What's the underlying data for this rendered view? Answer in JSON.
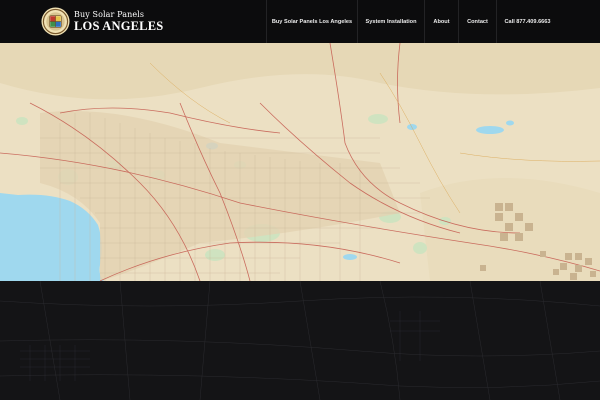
{
  "brand": {
    "line1": "Buy Solar Panels",
    "line2": "LOS ANGELES",
    "seal_icon": "city-seal-icon"
  },
  "nav": {
    "items": [
      {
        "label": "Buy Solar Panels Los Angeles"
      },
      {
        "label": "System Installation"
      },
      {
        "label": "About"
      },
      {
        "label": "Contact"
      },
      {
        "label": "Call 877.409.6663"
      }
    ]
  },
  "colors": {
    "header_bg": "#0c0c0d",
    "map_land": "#ece0c3",
    "map_ocean": "#9fd8ee",
    "map_park": "#cfe3c0",
    "dark_map_bg": "#141416",
    "nav_text": "#ececec"
  }
}
